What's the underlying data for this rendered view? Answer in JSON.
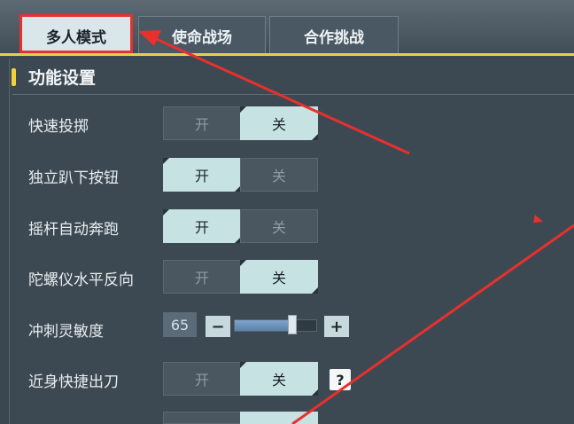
{
  "tabs": [
    {
      "label": "多人模式",
      "active": true
    },
    {
      "label": "使命战场",
      "active": false
    },
    {
      "label": "合作挑战",
      "active": false
    }
  ],
  "section": {
    "title": "功能设置"
  },
  "settings": [
    {
      "label": "快速投掷",
      "on_label": "开",
      "off_label": "关",
      "selected": "关"
    },
    {
      "label": "独立趴下按钮",
      "on_label": "开",
      "off_label": "关",
      "selected": "开"
    },
    {
      "label": "摇杆自动奔跑",
      "on_label": "开",
      "off_label": "关",
      "selected": "开"
    },
    {
      "label": "陀螺仪水平反向",
      "on_label": "开",
      "off_label": "关",
      "selected": "关"
    },
    {
      "label": "冲刺灵敏度",
      "value": "65",
      "minus": "−",
      "plus": "+",
      "fill_fraction": 0.72
    },
    {
      "label": "近身快捷出刀",
      "on_label": "开",
      "off_label": "关",
      "selected": "关",
      "help": "?"
    }
  ],
  "colors": {
    "highlight": "#e8302c",
    "accent": "#f2d23c",
    "toggle_on": "#c7e2e2",
    "slider_fill": "#6f93bc"
  }
}
